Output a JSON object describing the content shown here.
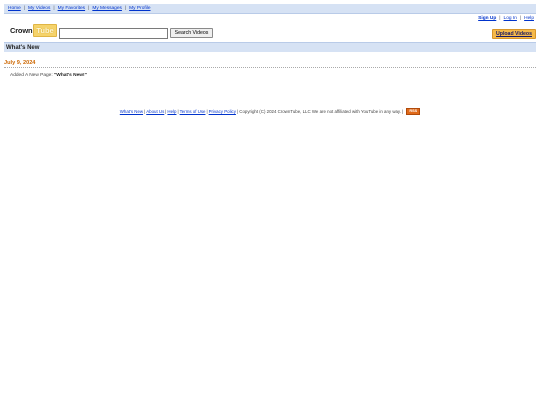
{
  "topnav": {
    "items": [
      "Home",
      "My Videos",
      "My Favorites",
      "My Messages",
      "My Profile"
    ],
    "separator": "|"
  },
  "userlinks": {
    "items": [
      "Sign Up",
      "Log In",
      "Help"
    ],
    "separator": "|"
  },
  "logo": {
    "part1": "Crown",
    "part2": "Tube"
  },
  "search": {
    "value": "",
    "button_label": "Search Videos"
  },
  "upload": {
    "label": "Upload Videos"
  },
  "section": {
    "title": "What's New"
  },
  "news": {
    "date": "July 9, 2024",
    "entry_prefix": "Added A New Page: ",
    "entry_highlight": "\"What's New!\""
  },
  "footer": {
    "links": [
      "What's New",
      "About Us",
      "Help",
      "Terms of Use",
      "Privacy Policy"
    ],
    "separator": "|",
    "copyright": "| Copyright (C) 2024 CrownTube, LLC We are not affiliated with YouTube in any way. |",
    "badge": "RSS"
  },
  "colors": {
    "nav_bg": "#d6e2f4",
    "link": "#0033cc",
    "accent_orange": "#cc6600",
    "upload_bg": "#f5b94a"
  }
}
